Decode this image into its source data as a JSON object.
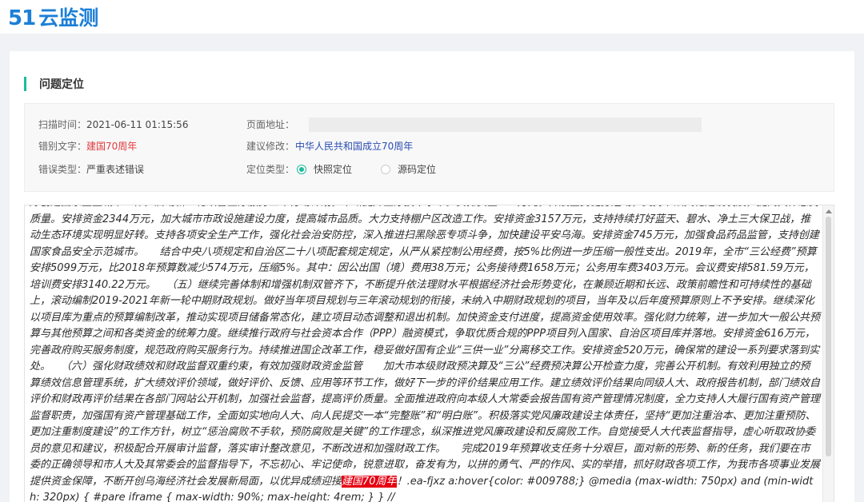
{
  "header": {
    "logo_number": "51",
    "logo_text": "云监测",
    "brand_color": "#1b7fd7"
  },
  "section": {
    "title": "问题定位",
    "accent_color": "#1abc9c"
  },
  "info": {
    "scan_time_label": "扫描时间：",
    "scan_time_value": "2021-06-11 01:15:56",
    "page_url_label": "页面地址：",
    "page_url_value": "",
    "error_text_label": "错别文字：",
    "error_text_value": "建国70周年",
    "suggestion_label": "建议修改：",
    "suggestion_value": "中华人民共和国成立70周年",
    "error_type_label": "错误类型：",
    "error_type_value": "严重表述错误",
    "locate_type_label": "定位类型：",
    "locate_option_quick": "快照定位",
    "locate_option_source": "源码定位",
    "locate_selected": "快照定位"
  },
  "content": {
    "paragraph": "好创建国家卫生城市工作。启动新一轮改善医疗服务三年行动计划，不断提升医疗技术水平。安排资金800万元，开展全民健身运动，支持书法文化建设发展，提高文体惠民质量。安排资金2344万元，加大城市市政设施建设力度，提高城市品质。大力支持棚户区改造工作。安排资金3157万元，支持持续打好蓝天、碧水、净土三大保卫战，推动生态环境实现明显好转。支持各项安全生产工作，强化社会治安防控，深入推进扫黑除恶专项斗争，加快建设平安乌海。安排资金745万元，加强食品药品监管，支持创建国家食品安全示范城市。　　结合中央八项规定和自治区二十八项配套规定规定，从严从紧控制公用经费，按5%比例进一步压缩一般性支出。2019年，全市“三公经费”预算安排5099万元，比2018年预算数减少574万元，压缩5%。其中：因公出国（境）费用38万元；公务接待费1658万元；公务用车费3403万元。会议费安排581.59万元，培训费安排3140.22万元。　　（五）继续完善体制和增强机制双管齐下，不断提升依法理财水平根据经济社会形势变化，在兼顾近期和长远、政策前瞻性和可持续性的基础上，滚动编制2019-2021年新一轮中期财政规划。做好当年项目规划与三年滚动规划的衔接，未纳入中期财政规划的项目，当年及以后年度预算原则上不予安排。继续深化以项目库为重点的预算编制改革，推动实现项目储备常态化，建立项目动态调整和退出机制。加快资金支付进度，提高资金使用效率。强化财力统筹，进一步加大一般公共预算与其他预算之间和各类资金的统筹力度。继续推行政府与社会资本合作（PPP）融资模式，争取优质合规的PPP项目列入国家、自治区项目库并落地。安排资金616万元，完善政府购买服务制度，规范政府购买服务行为。持续推进国企改革工作，稳妥做好国有企业“三供一业”分离移交工作。安排资金520万元，确保常的建设一系列要求落到实处。　　（六）强化财政绩效和财政监督双重约束，有效加强财政资金监管　　加大市本级财政预决算及“三公”经费预决算公开检查力度，完善公开机制。有效利用独立的预算绩效信息管理系统，扩大绩效评价领域，做好评价、反馈、应用等环节工作，做好下一步的评价结果应用工作。建立绩效评价结果向同级人大、政府报告机制，部门绩效自评价和财政再评价结果在各部门网站公开机制，加强社会监督，提高评价质量。全面推进政府向本级人大常委会报告国有资产管理情况制度，全力支持人大履行国有资产管理监督职责，加强国有资产管理基础工作，全面如实地向人大、向人民提交一本“完整账”和“明白账”。积极落实党风廉政建设主体责任，坚持“更加注重治本、更加注重预防、更加注重制度建设”的工作方针，树立“惩治腐败不手软，预防腐败是关键”的工作理念，纵深推进党风廉政建设和反腐败工作。自觉接受人大代表监督指导，虚心听取政协委员的意见和建议，积极配合开展审计监督，落实审计整改意见，不断改进和加强财政工作。　　完成2019年预算收支任务十分艰巨，面对新的形势、新的任务，我们要在市委的正确领导和市人大及其常委会的监督指导下，不忘初心、牢记使命，锐意进取，奋发有为，以拼的勇气、严的作风、实的举措，抓好财政各项工作，为我市各项事业发展提供资金保障，不断开创乌海经济社会发展新局面，以优异成绩迎接",
    "highlight": "建国70周年",
    "trailing": "！.ea-fjxz a:hover{color: #009788;} @media (max-width: 750px) and (min-width: 320px) { #pare iframe { max-width: 90%; max-height: 4rem; } } //",
    "highlight_color": "#e60012"
  }
}
